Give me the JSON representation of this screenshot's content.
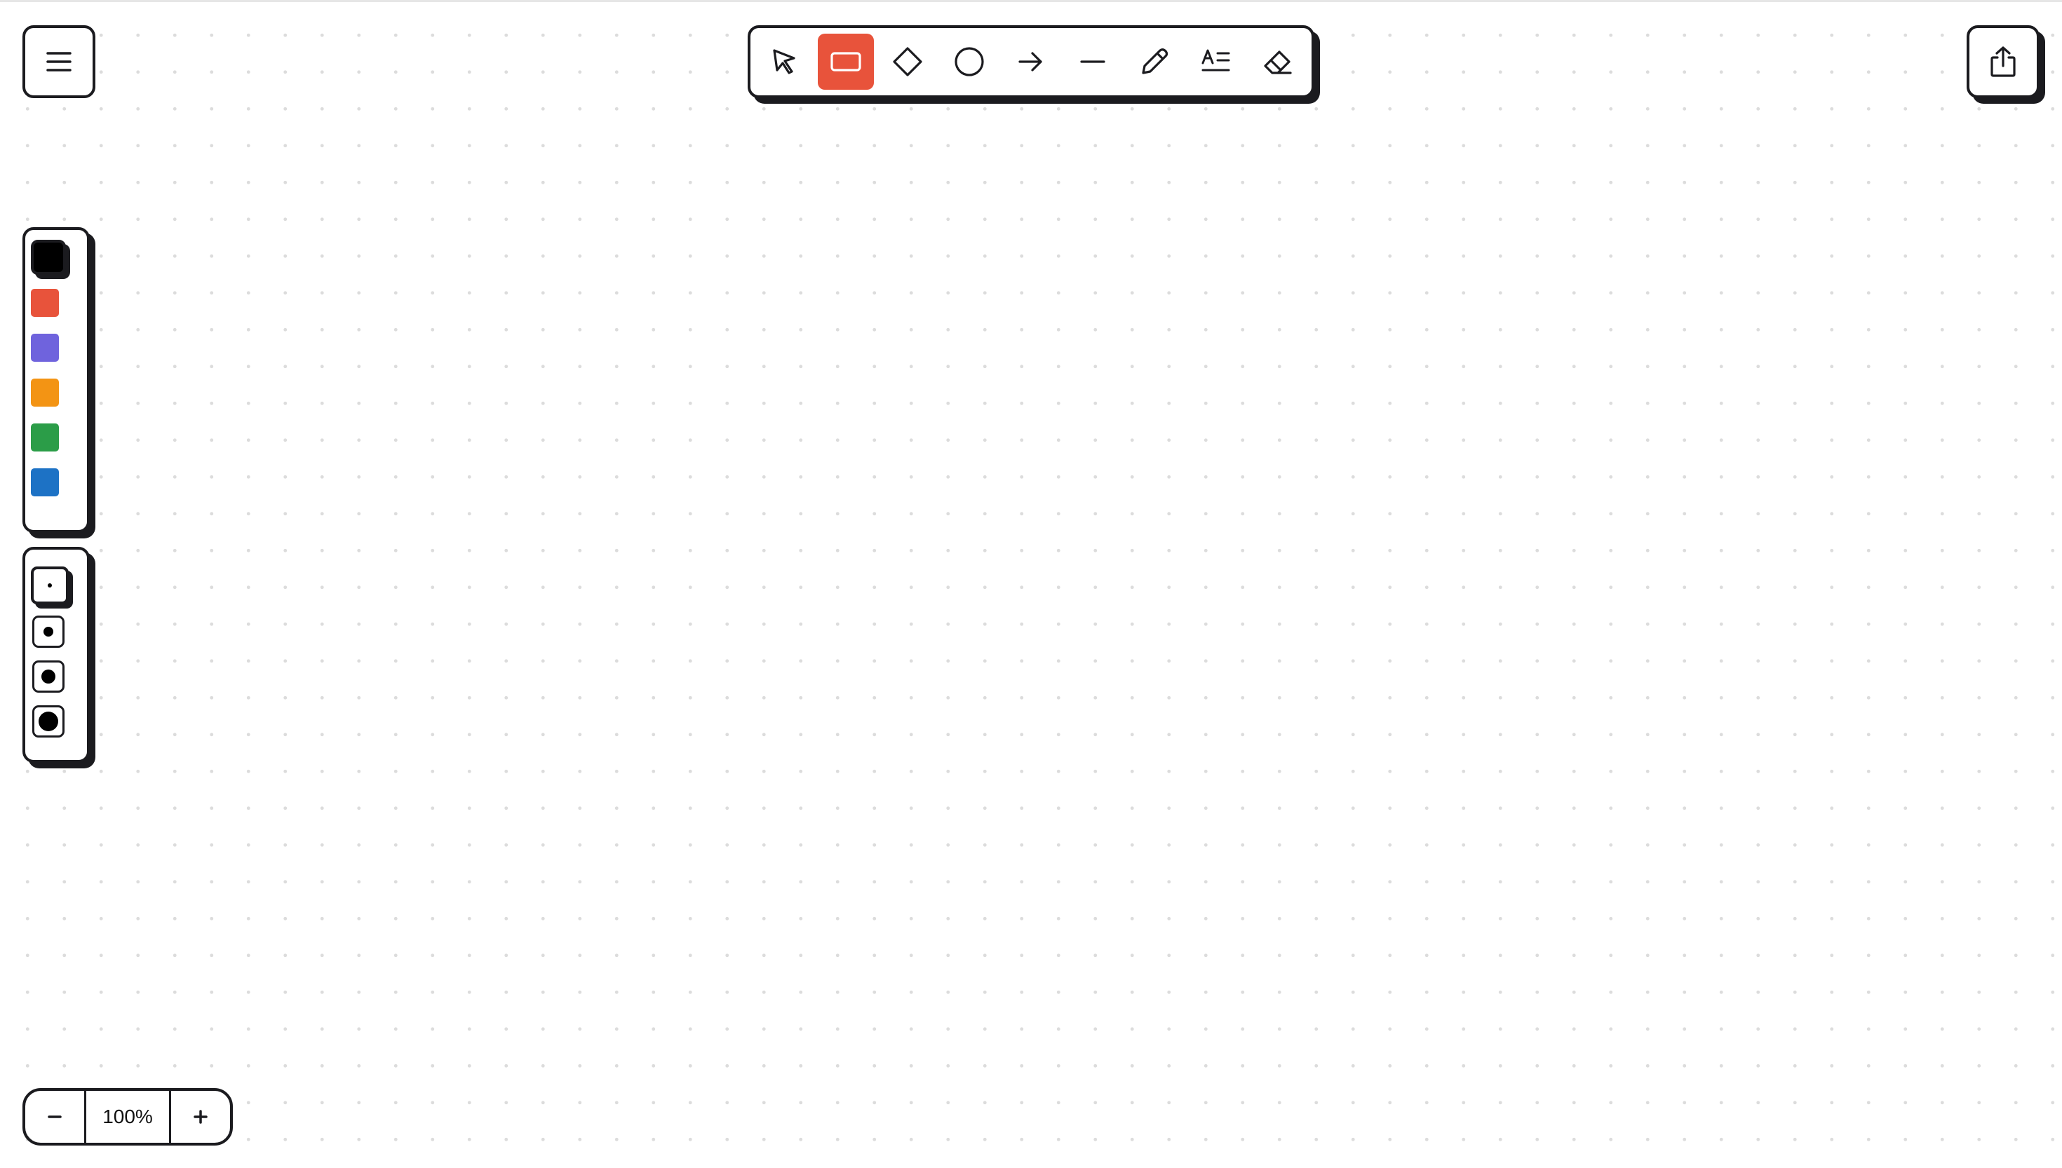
{
  "icons": {
    "menu": "hamburger-icon",
    "share": "share-icon"
  },
  "toolbar": {
    "tools": [
      {
        "name": "select",
        "icon": "pointer-icon",
        "active": false
      },
      {
        "name": "rectangle",
        "icon": "rectangle-icon",
        "active": true
      },
      {
        "name": "diamond",
        "icon": "diamond-icon",
        "active": false
      },
      {
        "name": "ellipse",
        "icon": "circle-icon",
        "active": false
      },
      {
        "name": "arrow",
        "icon": "arrow-right-icon",
        "active": false
      },
      {
        "name": "line",
        "icon": "line-icon",
        "active": false
      },
      {
        "name": "pencil",
        "icon": "pencil-icon",
        "active": false
      },
      {
        "name": "text",
        "icon": "text-icon",
        "active": false
      },
      {
        "name": "eraser",
        "icon": "eraser-icon",
        "active": false
      }
    ],
    "accent": "#e8533b"
  },
  "colors": {
    "swatches": [
      "#000000",
      "#e8533b",
      "#6f63dd",
      "#f39414",
      "#2b9d48",
      "#1d72c5"
    ],
    "selected_index": 0
  },
  "stroke_widths": {
    "options": [
      "thin",
      "medium",
      "bold",
      "extra-bold"
    ],
    "selected_index": 0
  },
  "zoom": {
    "level": "100%",
    "minus_label": "−",
    "plus_label": "+"
  }
}
